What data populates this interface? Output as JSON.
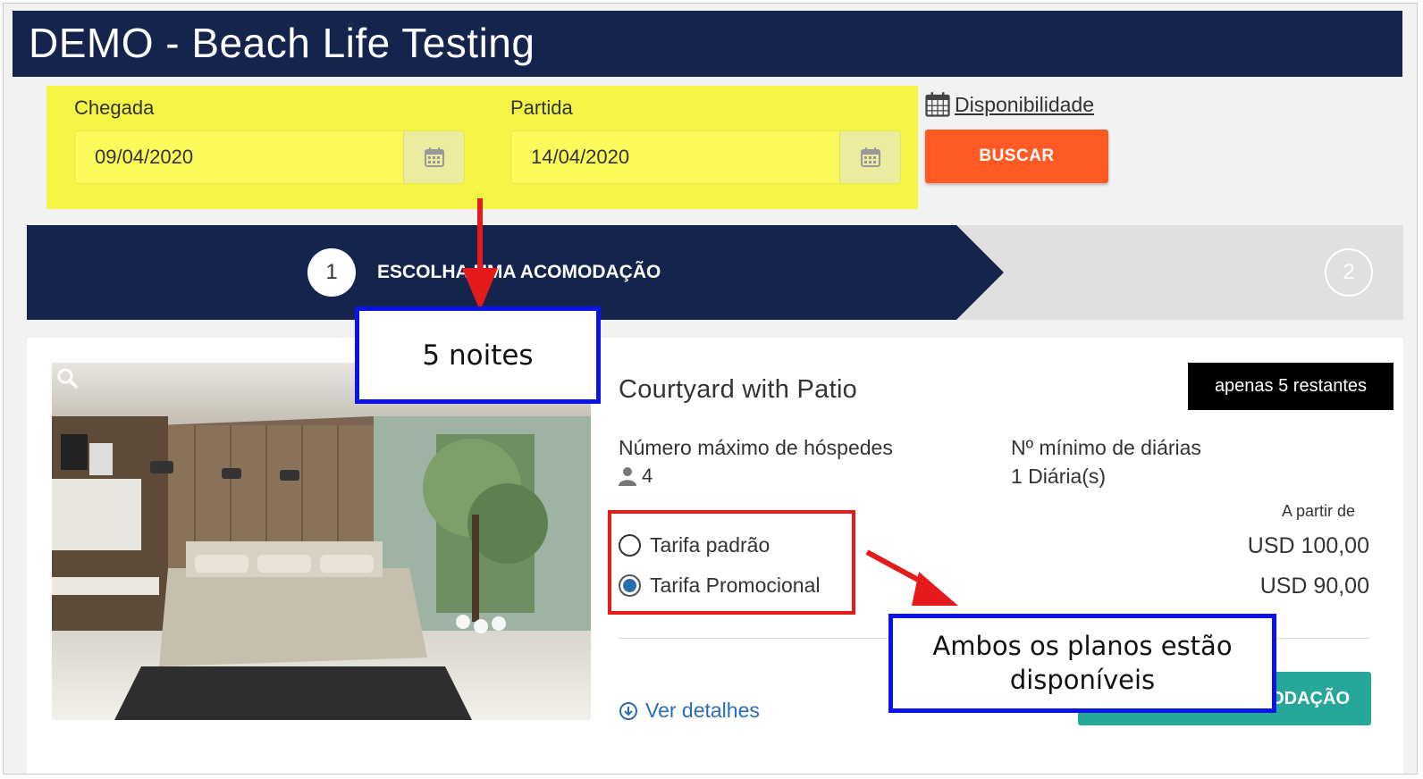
{
  "header": {
    "title": "DEMO - Beach Life Testing"
  },
  "search": {
    "checkin_label": "Chegada",
    "checkin_value": "09/04/2020",
    "checkout_label": "Partida",
    "checkout_value": "14/04/2020",
    "availability_link": "Disponibilidade",
    "search_button": "BUSCAR"
  },
  "steps": {
    "step1_number": "1",
    "step1_label": "ESCOLHA UMA ACOMODAÇÃO",
    "step2_number": "2"
  },
  "room": {
    "title": "Courtyard with Patio",
    "badge": "apenas 5 restantes",
    "max_guests_label": "Número máximo de hóspedes",
    "max_guests_value": "4",
    "min_nights_label": "Nº mínimo de diárias",
    "min_nights_value": "1 Diária(s)",
    "from_label": "A partir de",
    "rates": [
      {
        "label": "Tarifa padrão",
        "price": "USD 100,00",
        "selected": false
      },
      {
        "label": "Tarifa Promocional",
        "price": "USD 90,00",
        "selected": true
      }
    ],
    "details_link": "Ver detalhes",
    "choose_button": "ODAÇÃO"
  },
  "annotations": {
    "nights_callout": "5 noites",
    "plans_callout_line1": "Ambos os planos estão",
    "plans_callout_line2": "disponíveis"
  },
  "colors": {
    "header_bg": "#15244c",
    "highlight_yellow": "#f5f545",
    "search_button": "#ff5a24",
    "choose_button": "#27a69a",
    "annotation_red": "#e51b1b",
    "annotation_blue": "#0a14e6"
  }
}
